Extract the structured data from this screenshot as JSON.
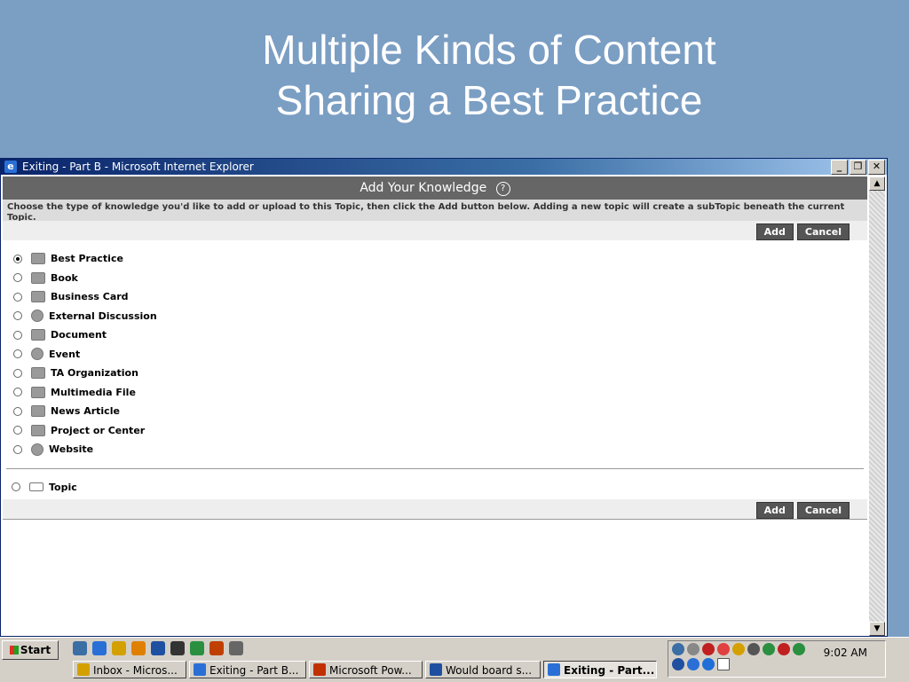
{
  "slide": {
    "title_line1": "Multiple Kinds of Content",
    "title_line2": "Sharing a Best Practice"
  },
  "window": {
    "title": "Exiting - Part B - Microsoft Internet Explorer",
    "minimize": "_",
    "restore": "❐",
    "close": "✕"
  },
  "form": {
    "header": "Add Your Knowledge",
    "help_icon": "?",
    "instructions": "Choose the type of knowledge you'd like to add or upload to this Topic, then click the Add button below. Adding a new topic will create a subTopic beneath the current Topic.",
    "add_label": "Add",
    "cancel_label": "Cancel",
    "options": [
      {
        "label": "Best Practice",
        "icon": "document-icon",
        "selected": true
      },
      {
        "label": "Book",
        "icon": "book-icon",
        "selected": false
      },
      {
        "label": "Business Card",
        "icon": "business-card-icon",
        "selected": false
      },
      {
        "label": "External Discussion",
        "icon": "discussion-icon",
        "selected": false
      },
      {
        "label": "Document",
        "icon": "document-icon",
        "selected": false
      },
      {
        "label": "Event",
        "icon": "clock-icon",
        "selected": false
      },
      {
        "label": "TA Organization",
        "icon": "organization-icon",
        "selected": false
      },
      {
        "label": "Multimedia File",
        "icon": "multimedia-icon",
        "selected": false
      },
      {
        "label": "News Article",
        "icon": "news-icon",
        "selected": false
      },
      {
        "label": "Project or Center",
        "icon": "project-icon",
        "selected": false
      },
      {
        "label": "Website",
        "icon": "globe-icon",
        "selected": false
      }
    ],
    "topic_label": "Topic"
  },
  "taskbar": {
    "start_label": "Start",
    "tasks": [
      {
        "label": "Inbox - Micros...",
        "active": false,
        "icon_color": "#d4a000"
      },
      {
        "label": "Exiting - Part B...",
        "active": false,
        "icon_color": "#2a6fd6"
      },
      {
        "label": "Microsoft Pow...",
        "active": false,
        "icon_color": "#c03000"
      },
      {
        "label": "Would board s...",
        "active": false,
        "icon_color": "#1f4fa0"
      },
      {
        "label": "Exiting - Part...",
        "active": true,
        "icon_color": "#2a6fd6"
      }
    ],
    "clock": "9:02 AM"
  },
  "colors": {
    "slide_bg": "#7b9ec3",
    "header_bg": "#666666",
    "button_bg": "#555555"
  }
}
